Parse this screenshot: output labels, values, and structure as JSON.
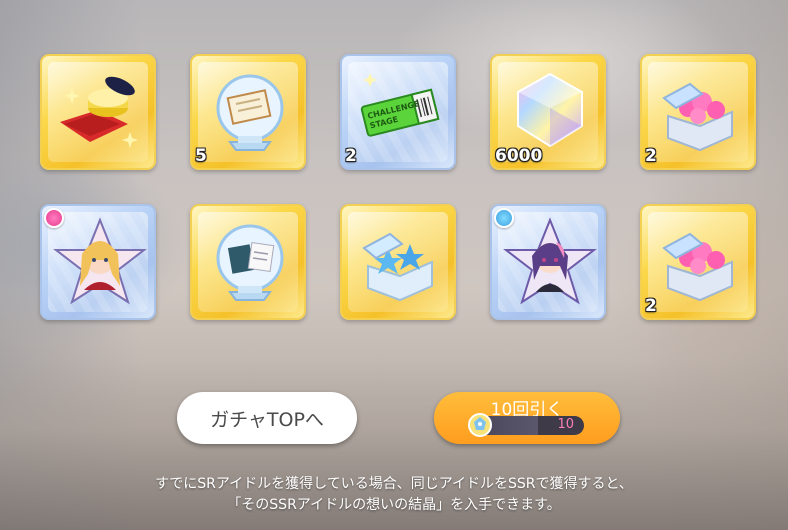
{
  "items": [
    {
      "name": "costume-kit",
      "rarity": "gold",
      "count": ""
    },
    {
      "name": "scroll-snow-globe",
      "rarity": "gold",
      "count": "5"
    },
    {
      "name": "challenge-stage-ticket",
      "rarity": "blue",
      "count": "2"
    },
    {
      "name": "rainbow-crystal",
      "rarity": "gold",
      "count": "6000"
    },
    {
      "name": "pink-gift-box",
      "rarity": "gold",
      "count": "2"
    },
    {
      "name": "idol-star-card-blonde",
      "rarity": "blue",
      "count": ""
    },
    {
      "name": "book-snow-globe",
      "rarity": "gold",
      "count": ""
    },
    {
      "name": "blue-gift-box",
      "rarity": "gold",
      "count": ""
    },
    {
      "name": "idol-star-card-pink-hair",
      "rarity": "blue",
      "count": ""
    },
    {
      "name": "pink-gift-box",
      "rarity": "gold",
      "count": "2"
    }
  ],
  "ticket": {
    "line1": "CHALLENGE",
    "line2": "STAGE"
  },
  "buttons": {
    "back_label": "ガチャTOPへ",
    "gacha_label": "10回引く",
    "gacha_cost": "10",
    "gacha_cost_fill": 0.59
  },
  "notice": {
    "line1": "すでにSRアイドルを獲得している場合、同じアイドルをSSRで獲得すると、",
    "line2": "「そのSSRアイドルの想いの結晶」を入手できます。"
  },
  "colors": {
    "gold_frame": "#f5c12a",
    "blue_frame": "#a7c3ee",
    "gacha_button": "#ff9d1e",
    "cost_text": "#ff7fb4"
  }
}
